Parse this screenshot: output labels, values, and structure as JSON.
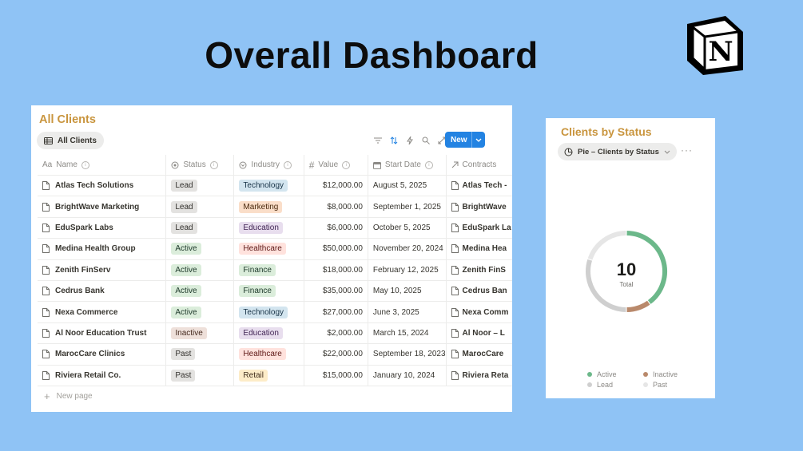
{
  "page": {
    "title": "Overall Dashboard"
  },
  "clients": {
    "title": "All Clients",
    "view_label": "All Clients",
    "new_label": "New",
    "columns": [
      "Name",
      "Status",
      "Industry",
      "Value",
      "Start Date",
      "Contracts"
    ],
    "rows": [
      {
        "name": "Atlas Tech Solutions",
        "status": "Lead",
        "industry": "Technology",
        "value": "$12,000.00",
        "start": "August 5, 2025",
        "contract": "Atlas Tech -"
      },
      {
        "name": "BrightWave Marketing",
        "status": "Lead",
        "industry": "Marketing",
        "value": "$8,000.00",
        "start": "September 1, 2025",
        "contract": "BrightWave"
      },
      {
        "name": "EduSpark Labs",
        "status": "Lead",
        "industry": "Education",
        "value": "$6,000.00",
        "start": "October 5, 2025",
        "contract": "EduSpark La"
      },
      {
        "name": "Medina Health Group",
        "status": "Active",
        "industry": "Healthcare",
        "value": "$50,000.00",
        "start": "November 20, 2024",
        "contract": "Medina Hea"
      },
      {
        "name": "Zenith FinServ",
        "status": "Active",
        "industry": "Finance",
        "value": "$18,000.00",
        "start": "February 12, 2025",
        "contract": "Zenith FinS"
      },
      {
        "name": "Cedrus Bank",
        "status": "Active",
        "industry": "Finance",
        "value": "$35,000.00",
        "start": "May 10, 2025",
        "contract": "Cedrus Ban"
      },
      {
        "name": "Nexa Commerce",
        "status": "Active",
        "industry": "Technology",
        "value": "$27,000.00",
        "start": "June 3, 2025",
        "contract": "Nexa Comm"
      },
      {
        "name": "Al Noor Education Trust",
        "status": "Inactive",
        "industry": "Education",
        "value": "$2,000.00",
        "start": "March 15, 2024",
        "contract": "Al Noor – L"
      },
      {
        "name": "MarocCare Clinics",
        "status": "Past",
        "industry": "Healthcare",
        "value": "$22,000.00",
        "start": "September 18, 2023",
        "contract": "MarocCare"
      },
      {
        "name": "Riviera Retail Co.",
        "status": "Past",
        "industry": "Retail",
        "value": "$15,000.00",
        "start": "January 10, 2024",
        "contract": "Riviera Reta"
      }
    ],
    "new_page_label": "New page",
    "status_colors": {
      "Lead": {
        "bg": "#e3e2e0",
        "fg": "#32302c"
      },
      "Active": {
        "bg": "#dbeddb",
        "fg": "#1c3829"
      },
      "Inactive": {
        "bg": "#eee0da",
        "fg": "#44291e"
      },
      "Past": {
        "bg": "#e3e2e0",
        "fg": "#32302c"
      }
    },
    "industry_colors": {
      "Technology": {
        "bg": "#d3e5ef",
        "fg": "#183347"
      },
      "Marketing": {
        "bg": "#fadec9",
        "fg": "#49290e"
      },
      "Education": {
        "bg": "#e8deee",
        "fg": "#412454"
      },
      "Healthcare": {
        "bg": "#ffe2dd",
        "fg": "#5d1715"
      },
      "Finance": {
        "bg": "#dbeddb",
        "fg": "#1c3829"
      },
      "Retail": {
        "bg": "#fdecc8",
        "fg": "#402c1b"
      }
    }
  },
  "status_chart": {
    "title": "Clients by Status",
    "view_label": "Pie – Clients by Status",
    "more_label": "···",
    "total": "10",
    "total_label": "Total",
    "chart_data": {
      "type": "pie",
      "categories": [
        "Active",
        "Inactive",
        "Lead",
        "Past"
      ],
      "values": [
        4,
        1,
        3,
        2
      ],
      "colors": [
        "#6cb88a",
        "#b9896b",
        "#cfcfcf",
        "#e6e6e6"
      ]
    },
    "legend": [
      {
        "label": "Active",
        "color": "#6cb88a"
      },
      {
        "label": "Inactive",
        "color": "#b9896b"
      },
      {
        "label": "Lead",
        "color": "#cfcfcf"
      },
      {
        "label": "Past",
        "color": "#e6e6e6"
      }
    ]
  }
}
